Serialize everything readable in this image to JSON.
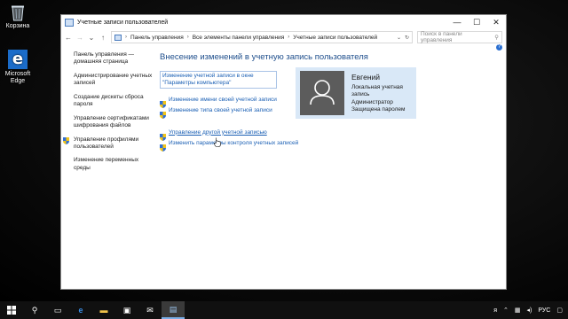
{
  "desktop": {
    "icons": [
      {
        "label": "Корзина",
        "icon": "recycle-bin-icon"
      },
      {
        "label": "Microsoft Edge",
        "icon": "edge-icon"
      }
    ]
  },
  "window": {
    "title": "Учетные записи пользователей",
    "controls": {
      "minimize": "—",
      "maximize": "☐",
      "close": "✕"
    }
  },
  "address": {
    "crumbs": [
      "Панель управления",
      "Все элементы панели управления",
      "Учетные записи пользователей"
    ],
    "search_placeholder": "Поиск в панели управления"
  },
  "leftnav": {
    "items": [
      "Панель управления — домашняя страница",
      "Администрирование учетных записей",
      "Создание дискеты сброса пароля",
      "Управление сертификатами шифрования файлов",
      "Управление профилями пользователей",
      "Изменение переменных среды"
    ]
  },
  "main": {
    "heading": "Внесение изменений в учетную запись пользователя",
    "settings_link": "Изменение учетной записи в окне \"Параметры компьютера\"",
    "rename_link": "Изменение имени своей учетной записи",
    "type_link": "Изменение типа своей учетной записи",
    "manage_other_link": "Управление другой учетной записью",
    "uac_link": "Изменить параметры контроля учетных записей"
  },
  "account": {
    "name": "Евгений",
    "type": "Локальная учетная запись",
    "role": "Администратор",
    "protection": "Защищена паролем"
  },
  "taskbar": {
    "language": "РУС"
  },
  "colors": {
    "link": "#1a5fb4",
    "heading": "#1e4e8c",
    "card": "#d9e8f7",
    "avatar": "#5c5c5c"
  }
}
